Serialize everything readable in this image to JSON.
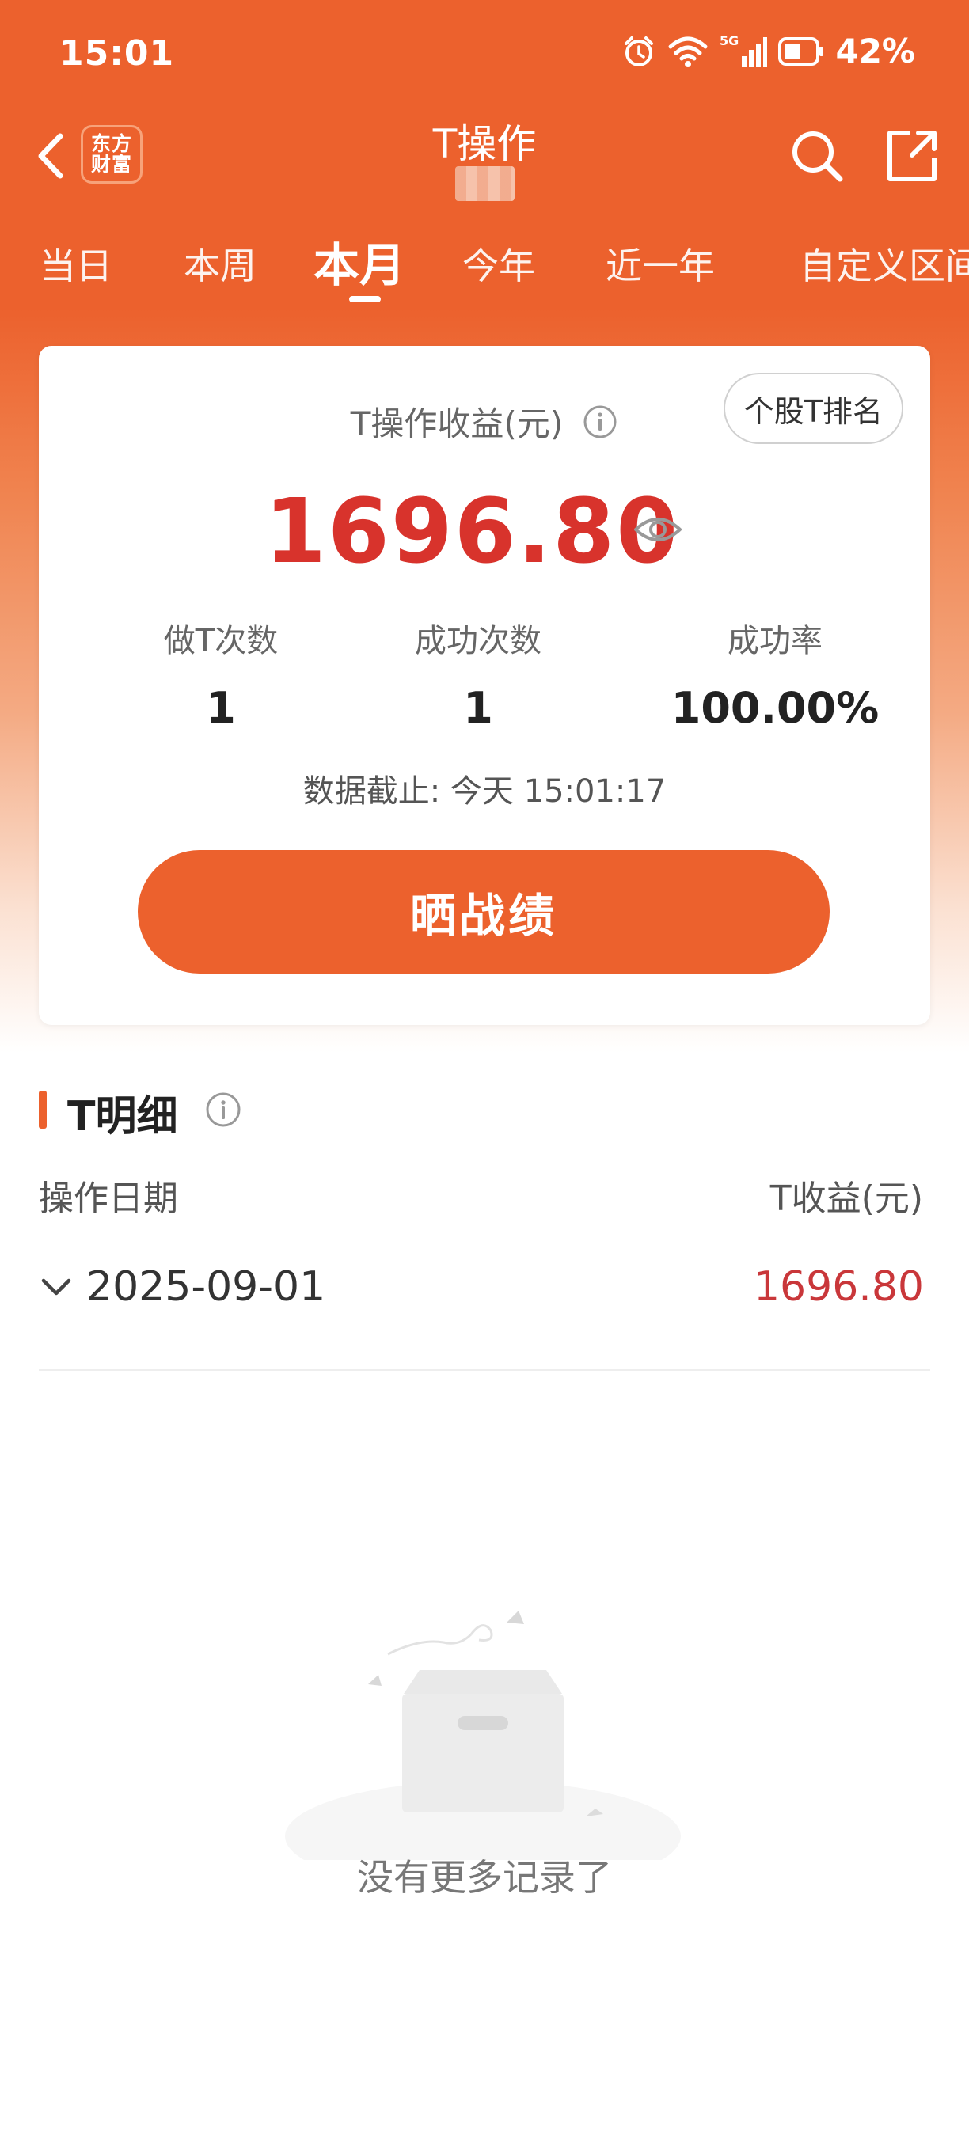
{
  "status_bar": {
    "time": "15:01",
    "network": "5G",
    "battery": "42%",
    "icons": [
      "alarm-icon",
      "wifi-icon",
      "signal-5g-icon",
      "battery-icon"
    ]
  },
  "header": {
    "back_icon": "back-arrow-icon",
    "brand": [
      "东方",
      "财富"
    ],
    "title": "T操作",
    "right_icons": [
      "search-icon",
      "share-icon"
    ]
  },
  "tabs": [
    {
      "label": "当日",
      "active": false
    },
    {
      "label": "本周",
      "active": false
    },
    {
      "label": "本月",
      "active": true
    },
    {
      "label": "今年",
      "active": false
    },
    {
      "label": "近一年",
      "active": false
    },
    {
      "label": "自定义区间",
      "active": false
    }
  ],
  "summary": {
    "rank_button": "个股T排名",
    "profit_label": "T操作收益(元)",
    "profit_value": "1696.80",
    "stats": [
      {
        "label": "做T次数",
        "value": "1"
      },
      {
        "label": "成功次数",
        "value": "1"
      },
      {
        "label": "成功率",
        "value": "100.00%"
      }
    ],
    "data_time": "数据截止: 今天 15:01:17",
    "share_button": "晒战绩"
  },
  "detail": {
    "title": "T明细",
    "columns": {
      "date": "操作日期",
      "profit": "T收益(元)"
    },
    "rows": [
      {
        "date": "2025-09-01",
        "profit": "1696.80"
      }
    ],
    "empty_text": "没有更多记录了"
  },
  "colors": {
    "brand_orange": "#ec612d",
    "profit_red": "#d8332c"
  }
}
